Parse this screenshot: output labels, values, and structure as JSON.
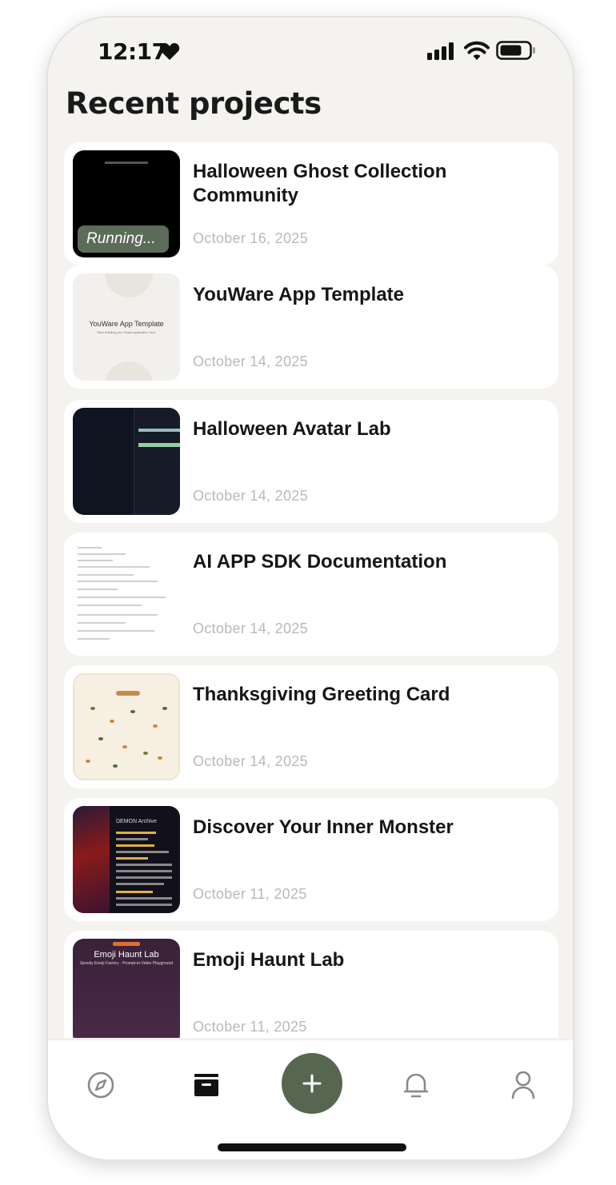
{
  "status_bar": {
    "time": "12:17"
  },
  "page": {
    "title": "Recent projects"
  },
  "projects": [
    {
      "title": "Halloween Ghost Collection Community",
      "date": "October 16, 2025",
      "status": "Running..."
    },
    {
      "title": "YouWare App Template",
      "date": "October 14, 2025",
      "thumb_title": "YouWare App Template",
      "thumb_subtitle": "Start building your React application here"
    },
    {
      "title": "Halloween Avatar Lab",
      "date": "October 14, 2025"
    },
    {
      "title": "AI APP SDK Documentation",
      "date": "October 14, 2025"
    },
    {
      "title": "Thanksgiving Greeting Card",
      "date": "October 14, 2025"
    },
    {
      "title": "Discover Your Inner Monster",
      "date": "October 11, 2025",
      "thumb_heading": "DEMON Archive"
    },
    {
      "title": "Emoji Haunt Lab",
      "date": "October 11, 2025",
      "thumb_title": "Emoji Haunt Lab",
      "thumb_subtitle": "Spooky Emoji Factory · Prompt-to-Video Playground"
    }
  ],
  "tabbar": {
    "items": [
      "compass-icon",
      "projects-icon",
      "plus-icon",
      "bell-icon",
      "profile-icon"
    ],
    "accent": "#566650"
  }
}
